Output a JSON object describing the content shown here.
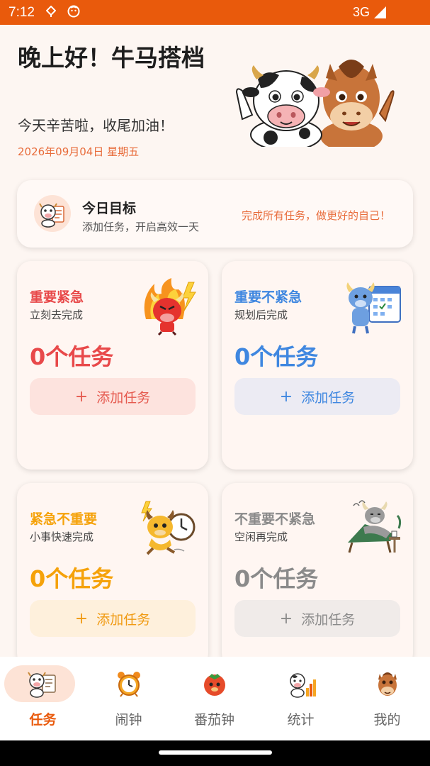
{
  "status_bar": {
    "time": "7:12",
    "network": "3G",
    "left_icons": [
      "download-icon",
      "face-icon"
    ]
  },
  "header": {
    "greeting": "晚上好！牛马搭档",
    "subtitle": "今天辛苦啦，收尾加油！",
    "date": "2026年09月04日  星期五"
  },
  "goal": {
    "title": "今日目标",
    "subtitle": "添加任务，开启高效一天",
    "motto": "完成所有任务，做更好的自己！"
  },
  "quadrants": [
    {
      "title": "重要紧急",
      "subtitle": "立刻去完成",
      "count": "0个任务",
      "button": "添加任务",
      "color": "#e8494a"
    },
    {
      "title": "重要不紧急",
      "subtitle": "规划后完成",
      "count": "0个任务",
      "button": "添加任务",
      "color": "#3f87e0"
    },
    {
      "title": "紧急不重要",
      "subtitle": "小事快速完成",
      "count": "0个任务",
      "button": "添加任务",
      "color": "#f5a20a"
    },
    {
      "title": "不重要不紧急",
      "subtitle": "空闲再完成",
      "count": "0个任务",
      "button": "添加任务",
      "color": "#8a8a8a"
    }
  ],
  "nav": [
    {
      "label": "任务",
      "icon": "cow-clipboard-icon",
      "active": true
    },
    {
      "label": "闹钟",
      "icon": "alarm-clock-icon",
      "active": false
    },
    {
      "label": "番茄钟",
      "icon": "tomato-icon",
      "active": false
    },
    {
      "label": "统计",
      "icon": "chart-icon",
      "active": false
    },
    {
      "label": "我的",
      "icon": "horse-icon",
      "active": false
    }
  ],
  "colors": {
    "accent": "#e95a0c",
    "status_bar": "#e95a0c",
    "background": "#fdf6f2"
  }
}
